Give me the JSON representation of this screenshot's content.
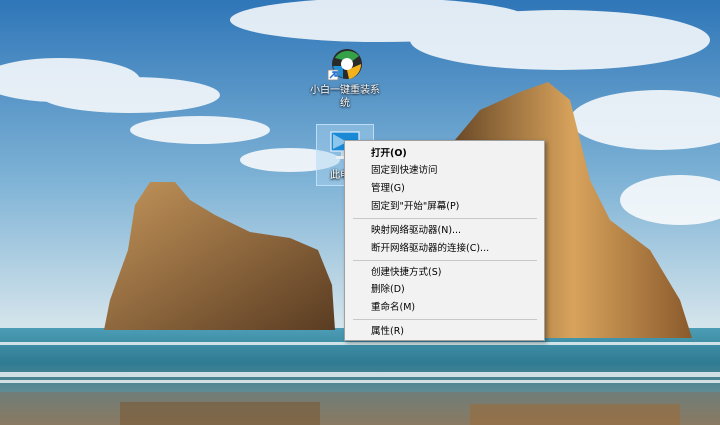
{
  "desktop": {
    "icons": [
      {
        "label": "小白一键重装系统"
      },
      {
        "label": "此电"
      }
    ]
  },
  "context_menu": {
    "groups": [
      [
        {
          "label": "打开(O)",
          "bold": true
        },
        {
          "label": "固定到快速访问"
        },
        {
          "label": "管理(G)"
        },
        {
          "label": "固定到\"开始\"屏幕(P)"
        }
      ],
      [
        {
          "label": "映射网络驱动器(N)..."
        },
        {
          "label": "断开网络驱动器的连接(C)..."
        }
      ],
      [
        {
          "label": "创建快捷方式(S)"
        },
        {
          "label": "删除(D)"
        },
        {
          "label": "重命名(M)"
        }
      ],
      [
        {
          "label": "属性(R)"
        }
      ]
    ]
  },
  "colors": {
    "sky_top": "#3b7fc0",
    "sky_bottom": "#cfe3ef",
    "sea": "#3d8aa6",
    "rock": "#9a6a3a",
    "menu_bg": "#f2f2f2"
  }
}
